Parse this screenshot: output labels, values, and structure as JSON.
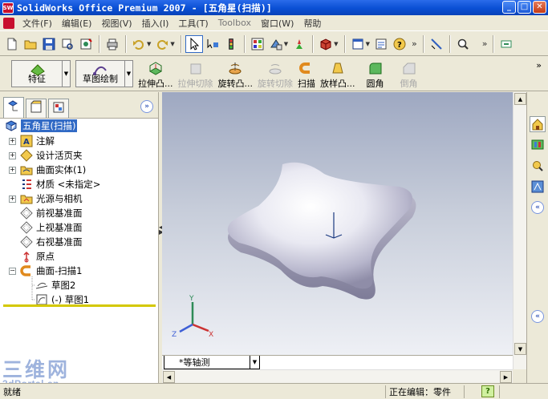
{
  "window": {
    "app_badge": "SW",
    "title": "SolidWorks Office Premium 2007 - [五角星(扫描)]",
    "minimize": "_",
    "maximize": "□",
    "close": "✕"
  },
  "menu": {
    "items": [
      {
        "label": "文件(F)"
      },
      {
        "label": "编辑(E)"
      },
      {
        "label": "视图(V)"
      },
      {
        "label": "插入(I)"
      },
      {
        "label": "工具(T)"
      },
      {
        "label": "Toolbox"
      },
      {
        "label": "窗口(W)"
      },
      {
        "label": "帮助"
      }
    ]
  },
  "toolbar": {
    "icons": [
      "new-icon",
      "open-icon",
      "save-icon",
      "print-preview-icon",
      "options-icon",
      "print-icon",
      "undo-icon",
      "redo-icon",
      "select-icon",
      "select-filter-icon",
      "traffic-light-icon",
      "grid-icon",
      "view-icon",
      "rebuild-icon",
      "display-icon",
      "window-icon",
      "property-icon",
      "help-icon",
      "measure-icon",
      "zoom-icon"
    ],
    "overflow": "»",
    "overflow2": "»"
  },
  "commands": {
    "feature_label": "特征",
    "sketch_label": "草图绘制",
    "items": [
      {
        "label": "拉伸凸...",
        "disabled": false
      },
      {
        "label": "拉伸切除",
        "disabled": true
      },
      {
        "label": "旋转凸...",
        "disabled": false
      },
      {
        "label": "旋转切除",
        "disabled": true
      },
      {
        "label": "扫描",
        "disabled": false
      },
      {
        "label": "放样凸...",
        "disabled": false
      },
      {
        "label": "圆角",
        "disabled": false
      },
      {
        "label": "倒角",
        "disabled": true
      }
    ],
    "overflow": "»"
  },
  "feature_manager": {
    "expand_label": "»",
    "tree": [
      {
        "label": "五角星(扫描)",
        "icon": "part-icon",
        "expander": "",
        "selected": true
      },
      {
        "label": "注解",
        "icon": "annotation-icon",
        "expander": "+"
      },
      {
        "label": "设计活页夹",
        "icon": "design-binder-icon",
        "expander": "+"
      },
      {
        "label": "曲面实体(1)",
        "icon": "surface-bodies-icon",
        "expander": "+"
      },
      {
        "label": "材质 <未指定>",
        "icon": "material-icon",
        "expander": ""
      },
      {
        "label": "光源与相机",
        "icon": "lights-camera-icon",
        "expander": "+"
      },
      {
        "label": "前视基准面",
        "icon": "plane-icon",
        "expander": ""
      },
      {
        "label": "上视基准面",
        "icon": "plane-icon",
        "expander": ""
      },
      {
        "label": "右视基准面",
        "icon": "plane-icon",
        "expander": ""
      },
      {
        "label": "原点",
        "icon": "origin-icon",
        "expander": ""
      },
      {
        "label": "曲面-扫描1",
        "icon": "sweep-surface-icon",
        "expander": "−"
      },
      {
        "label": "草图2",
        "icon": "sketch-icon",
        "expander": ""
      },
      {
        "label": "(-) 草图1",
        "icon": "sketch-icon",
        "expander": ""
      }
    ]
  },
  "viewport": {
    "view_orientation": "*等轴测",
    "triad": {
      "x": "X",
      "y": "Y",
      "z": "Z"
    }
  },
  "taskpane": {
    "collapse_label": "«"
  },
  "status": {
    "left": "就绪",
    "editing": "正在编辑：零件",
    "help": "?"
  },
  "watermark": {
    "line1": "三维网",
    "line2": "3dPortal.cn"
  }
}
